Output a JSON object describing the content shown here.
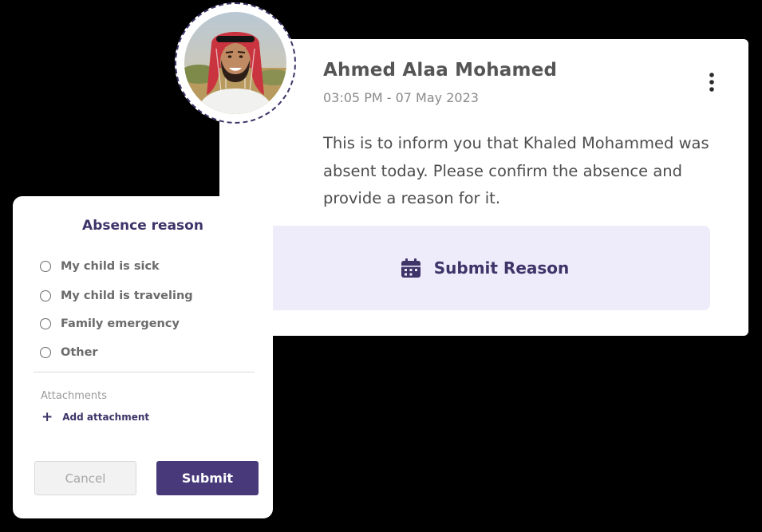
{
  "message": {
    "sender_name": "Ahmed Alaa Mohamed",
    "timestamp": "03:05 PM - 07 May 2023",
    "body": "This is to inform you that Khaled Mohammed was absent today. Please confirm the absence and provide a reason for it.",
    "action_label": "Submit Reason",
    "action_icon": "calendar-icon",
    "menu_icon": "more-vertical-icon"
  },
  "modal": {
    "title": "Absence reason",
    "options": [
      "My child is sick",
      "My child is traveling",
      "Family emergency",
      "Other"
    ],
    "attachments_label": "Attachments",
    "add_attachment_label": "Add attachment",
    "cancel_label": "Cancel",
    "submit_label": "Submit"
  },
  "colors": {
    "accent": "#47397a",
    "accent_text": "#3e3468",
    "action_background": "#eeebfb",
    "page_background": "#000000"
  }
}
